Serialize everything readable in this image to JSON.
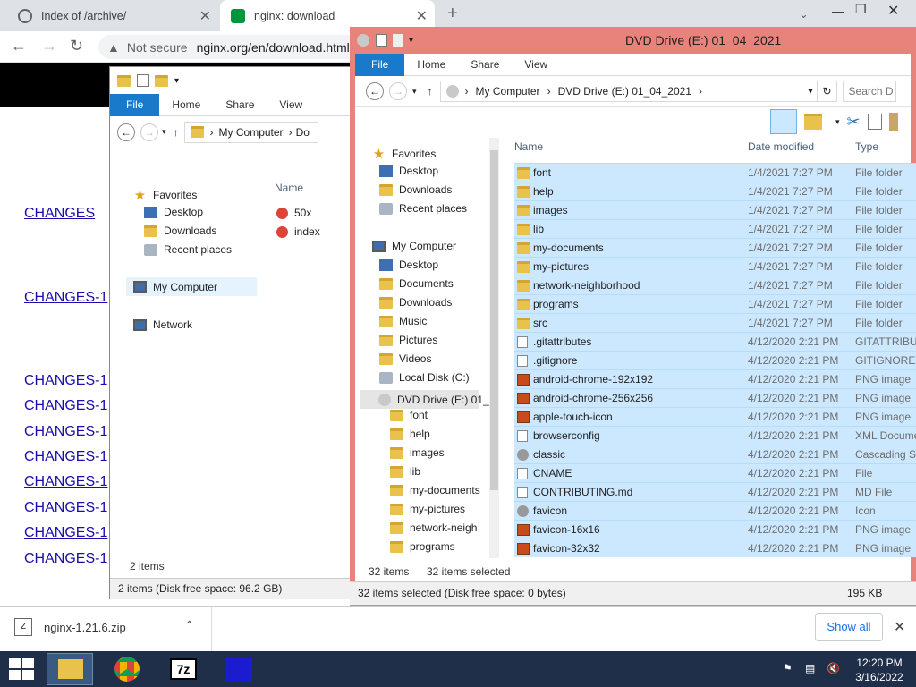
{
  "chrome": {
    "tab1": "Index of /archive/",
    "tab2": "nginx: download",
    "not_secure": "Not secure",
    "url": "nginx.org/en/download.html"
  },
  "page_links": [
    "CHANGES",
    "CHANGES-1",
    "CHANGES-1",
    "CHANGES-1",
    "CHANGES-1",
    "CHANGES-1",
    "CHANGES-1",
    "CHANGES-1",
    "CHANGES-1",
    "CHANGES-1"
  ],
  "win_left": {
    "ribbon": [
      "File",
      "Home",
      "Share",
      "View"
    ],
    "breadcrumb": [
      "My Computer",
      "Do"
    ],
    "tree": {
      "favorites": "Favorites",
      "desktop": "Desktop",
      "downloads": "Downloads",
      "recent": "Recent places",
      "mycomputer": "My Computer",
      "network": "Network"
    },
    "col_name": "Name",
    "files": [
      "50x",
      "index"
    ],
    "status_items": "2 items",
    "status_disk": "2 items (Disk free space: 96.2 GB)"
  },
  "win_right": {
    "title": "DVD Drive (E:) 01_04_2021",
    "ribbon": [
      "File",
      "Home",
      "Share",
      "View"
    ],
    "breadcrumb": [
      "My Computer",
      "DVD Drive (E:) 01_04_2021"
    ],
    "search_placeholder": "Search D",
    "tree": [
      "Favorites",
      "Desktop",
      "Downloads",
      "Recent places",
      "My Computer",
      "Desktop",
      "Documents",
      "Downloads",
      "Music",
      "Pictures",
      "Videos",
      "Local Disk (C:)",
      "DVD Drive (E:) 01_",
      "font",
      "help",
      "images",
      "lib",
      "my-documents",
      "my-pictures",
      "network-neigh",
      "programs"
    ],
    "columns": {
      "name": "Name",
      "date": "Date modified",
      "type": "Type"
    },
    "rows": [
      {
        "name": "font",
        "date": "1/4/2021 7:27 PM",
        "type": "File folder",
        "icon": "folder"
      },
      {
        "name": "help",
        "date": "1/4/2021 7:27 PM",
        "type": "File folder",
        "icon": "folder"
      },
      {
        "name": "images",
        "date": "1/4/2021 7:27 PM",
        "type": "File folder",
        "icon": "folder"
      },
      {
        "name": "lib",
        "date": "1/4/2021 7:27 PM",
        "type": "File folder",
        "icon": "folder"
      },
      {
        "name": "my-documents",
        "date": "1/4/2021 7:27 PM",
        "type": "File folder",
        "icon": "folder"
      },
      {
        "name": "my-pictures",
        "date": "1/4/2021 7:27 PM",
        "type": "File folder",
        "icon": "folder"
      },
      {
        "name": "network-neighborhood",
        "date": "1/4/2021 7:27 PM",
        "type": "File folder",
        "icon": "folder"
      },
      {
        "name": "programs",
        "date": "1/4/2021 7:27 PM",
        "type": "File folder",
        "icon": "folder"
      },
      {
        "name": "src",
        "date": "1/4/2021 7:27 PM",
        "type": "File folder",
        "icon": "folder"
      },
      {
        "name": ".gitattributes",
        "date": "4/12/2020 2:21 PM",
        "type": "GITATTRIBUT",
        "icon": "file"
      },
      {
        "name": ".gitignore",
        "date": "4/12/2020 2:21 PM",
        "type": "GITIGNORE F",
        "icon": "file"
      },
      {
        "name": "android-chrome-192x192",
        "date": "4/12/2020 2:21 PM",
        "type": "PNG image",
        "icon": "image"
      },
      {
        "name": "android-chrome-256x256",
        "date": "4/12/2020 2:21 PM",
        "type": "PNG image",
        "icon": "image"
      },
      {
        "name": "apple-touch-icon",
        "date": "4/12/2020 2:21 PM",
        "type": "PNG image",
        "icon": "image"
      },
      {
        "name": "browserconfig",
        "date": "4/12/2020 2:21 PM",
        "type": "XML Docume",
        "icon": "file"
      },
      {
        "name": "classic",
        "date": "4/12/2020 2:21 PM",
        "type": "Cascading St",
        "icon": "gear"
      },
      {
        "name": "CNAME",
        "date": "4/12/2020 2:21 PM",
        "type": "File",
        "icon": "file"
      },
      {
        "name": "CONTRIBUTING.md",
        "date": "4/12/2020 2:21 PM",
        "type": "MD File",
        "icon": "file"
      },
      {
        "name": "favicon",
        "date": "4/12/2020 2:21 PM",
        "type": "Icon",
        "icon": "gear"
      },
      {
        "name": "favicon-16x16",
        "date": "4/12/2020 2:21 PM",
        "type": "PNG image",
        "icon": "image"
      },
      {
        "name": "favicon-32x32",
        "date": "4/12/2020 2:21 PM",
        "type": "PNG image",
        "icon": "image"
      }
    ],
    "status_items": "32 items",
    "status_selected": "32 items selected",
    "bottom_status": "32 items selected (Disk free space: 0 bytes)",
    "bottom_size": "195 KB"
  },
  "downloads": {
    "file": "nginx-1.21.6.zip",
    "show_all": "Show all"
  },
  "taskbar": {
    "time": "12:20 PM",
    "date": "3/16/2022",
    "sevenzip": "7z"
  }
}
